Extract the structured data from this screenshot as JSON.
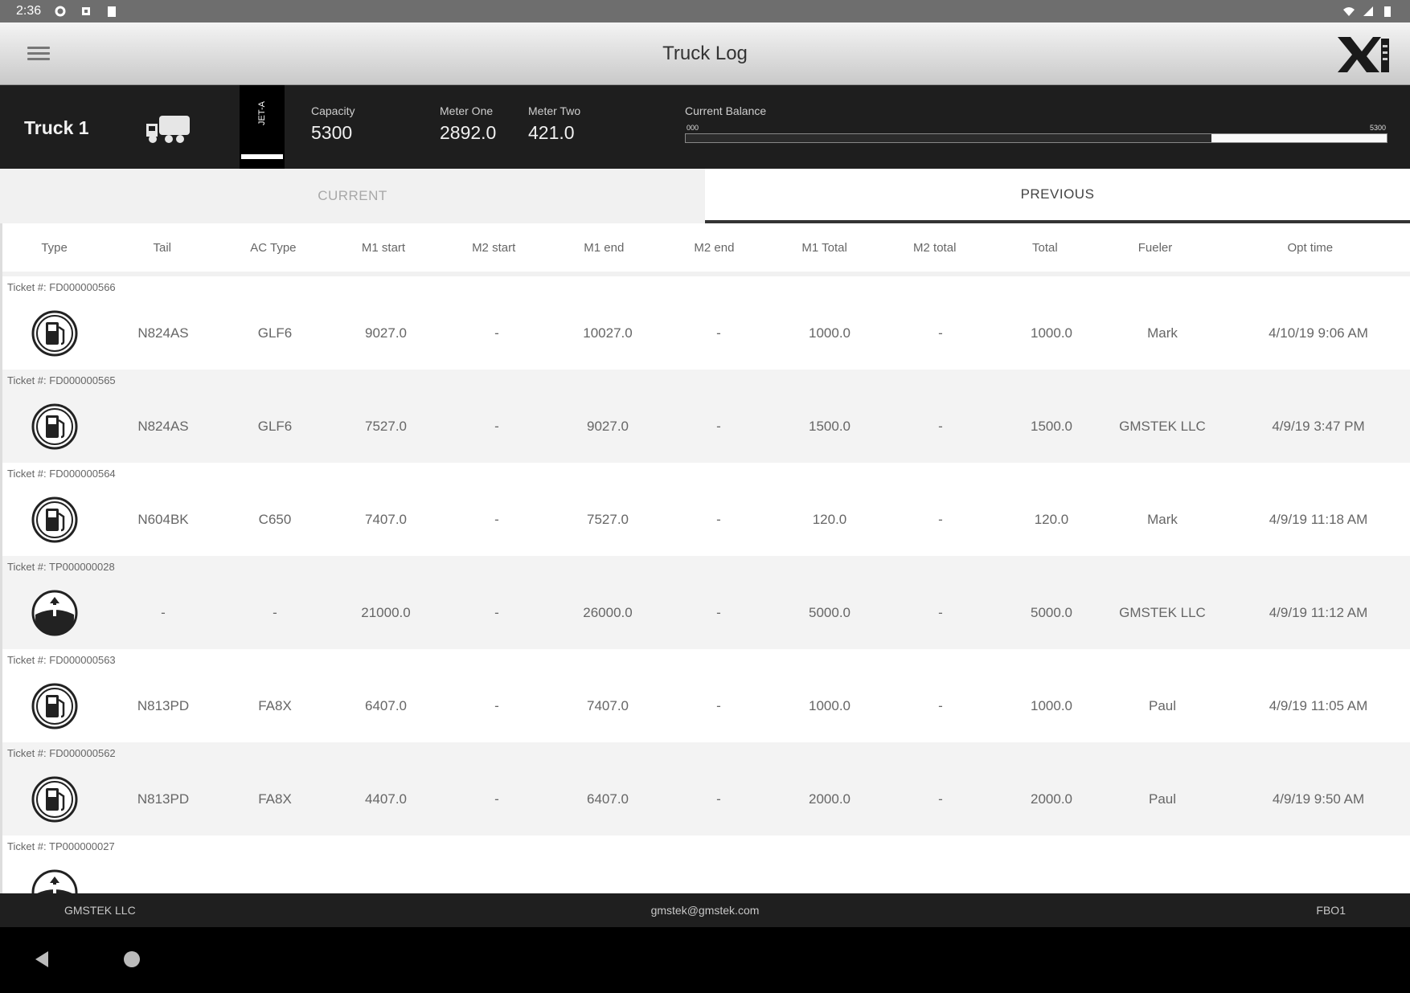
{
  "status_bar": {
    "time": "2:36"
  },
  "app_bar": {
    "title": "Truck Log"
  },
  "truck": {
    "name": "Truck 1",
    "tab_label": "JET-A",
    "capacity_label": "Capacity",
    "capacity_value": "5300",
    "meter_one_label": "Meter One",
    "meter_one_value": "2892.0",
    "meter_two_label": "Meter Two",
    "meter_two_value": "421.0",
    "balance_label": "Current Balance",
    "balance_min": "000",
    "balance_max": "5300",
    "balance_fraction": 0.25
  },
  "tabs": {
    "current": "CURRENT",
    "previous": "PREVIOUS"
  },
  "columns": [
    "Type",
    "Tail",
    "AC Type",
    "M1 start",
    "M2 start",
    "M1 end",
    "M2 end",
    "M1 Total",
    "M2 total",
    "Total",
    "Fueler",
    "Opt time"
  ],
  "entries": [
    {
      "ticket": "Ticket #: FD000000566",
      "icon": "fuel-pump-icon",
      "cells": [
        "N824AS",
        "GLF6",
        "9027.0",
        "-",
        "10027.0",
        "-",
        "1000.0",
        "-",
        "1000.0",
        "Mark",
        "4/10/19 9:06 AM"
      ]
    },
    {
      "ticket": "Ticket #: FD000000565",
      "icon": "fuel-pump-icon",
      "cells": [
        "N824AS",
        "GLF6",
        "7527.0",
        "-",
        "9027.0",
        "-",
        "1500.0",
        "-",
        "1500.0",
        "GMSTEK LLC",
        "4/9/19 3:47 PM"
      ]
    },
    {
      "ticket": "Ticket #: FD000000564",
      "icon": "fuel-pump-icon",
      "cells": [
        "N604BK",
        "C650",
        "7407.0",
        "-",
        "7527.0",
        "-",
        "120.0",
        "-",
        "120.0",
        "Mark",
        "4/9/19 11:18 AM"
      ]
    },
    {
      "ticket": "Ticket #: TP000000028",
      "icon": "tank-fill-icon",
      "cells": [
        "-",
        "-",
        "21000.0",
        "-",
        "26000.0",
        "-",
        "5000.0",
        "-",
        "5000.0",
        "GMSTEK LLC",
        "4/9/19 11:12 AM"
      ]
    },
    {
      "ticket": "Ticket #: FD000000563",
      "icon": "fuel-pump-icon",
      "cells": [
        "N813PD",
        "FA8X",
        "6407.0",
        "-",
        "7407.0",
        "-",
        "1000.0",
        "-",
        "1000.0",
        "Paul",
        "4/9/19 11:05 AM"
      ]
    },
    {
      "ticket": "Ticket #: FD000000562",
      "icon": "fuel-pump-icon",
      "cells": [
        "N813PD",
        "FA8X",
        "4407.0",
        "-",
        "6407.0",
        "-",
        "2000.0",
        "-",
        "2000.0",
        "Paul",
        "4/9/19 9:50 AM"
      ]
    },
    {
      "ticket": "Ticket #: TP000000027",
      "icon": "tank-fill-icon",
      "cells": [
        "",
        "",
        "",
        "",
        "",
        "",
        "",
        "",
        "",
        "",
        ""
      ]
    }
  ],
  "footer": {
    "company": "GMSTEK LLC",
    "email": "gmstek@gmstek.com",
    "code": "FBO1"
  }
}
